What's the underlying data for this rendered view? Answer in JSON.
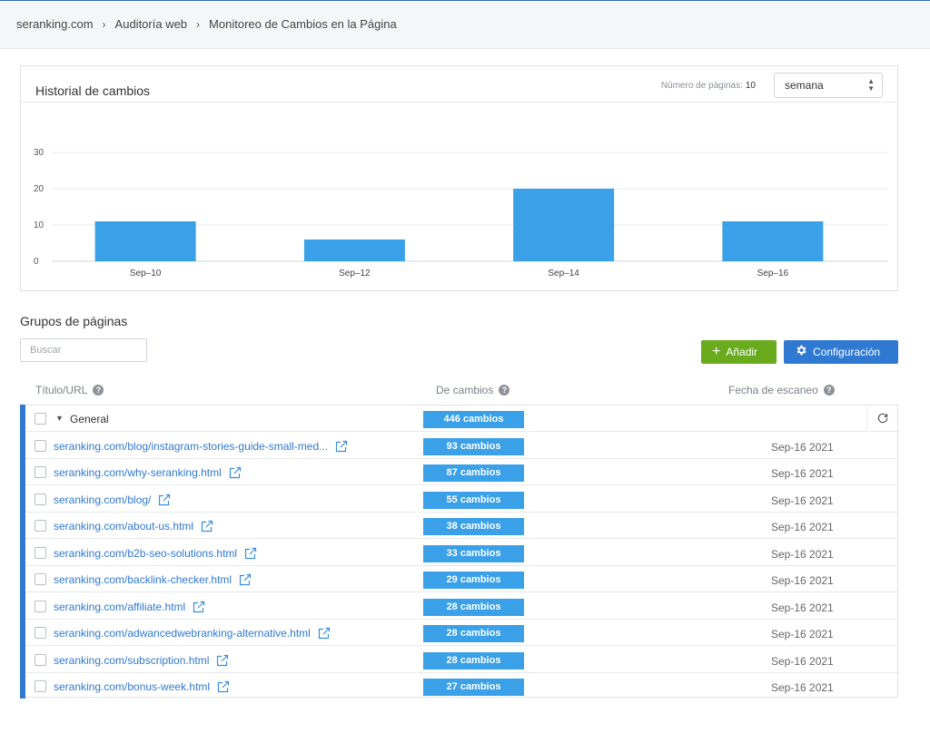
{
  "breadcrumb": [
    "seranking.com",
    "Auditoría web",
    "Monitoreo de Cambios en la Página"
  ],
  "breadcrumb_sep": "›",
  "history": {
    "title": "Historial de cambios",
    "pages_label": "Número de páginas:",
    "pages_value": "10",
    "period": "semana"
  },
  "chart_data": {
    "type": "bar",
    "categories": [
      "Sep–10",
      "Sep–12",
      "Sep–14",
      "Sep–16"
    ],
    "values": [
      11,
      6,
      20,
      11
    ],
    "yticks": [
      0,
      10,
      20,
      30
    ],
    "ylim": [
      0,
      30
    ],
    "grid": true,
    "color": "#3aa0e8"
  },
  "groups": {
    "title": "Grupos de páginas",
    "search_placeholder": "Buscar",
    "add_label": "Añadir",
    "config_label": "Configuración"
  },
  "columns": {
    "title": "Título/URL",
    "changes": "De cambios",
    "date": "Fecha de escaneo"
  },
  "group_row": {
    "label": "General",
    "changes": "446 cambios"
  },
  "rows": [
    {
      "url": "seranking.com/blog/instagram-stories-guide-small-med...",
      "changes": "93 cambios",
      "date": "Sep-16 2021"
    },
    {
      "url": "seranking.com/why-seranking.html",
      "changes": "87 cambios",
      "date": "Sep-16 2021"
    },
    {
      "url": "seranking.com/blog/",
      "changes": "55 cambios",
      "date": "Sep-16 2021"
    },
    {
      "url": "seranking.com/about-us.html",
      "changes": "38 cambios",
      "date": "Sep-16 2021"
    },
    {
      "url": "seranking.com/b2b-seo-solutions.html",
      "changes": "33 cambios",
      "date": "Sep-16 2021"
    },
    {
      "url": "seranking.com/backlink-checker.html",
      "changes": "29 cambios",
      "date": "Sep-16 2021"
    },
    {
      "url": "seranking.com/affiliate.html",
      "changes": "28 cambios",
      "date": "Sep-16 2021"
    },
    {
      "url": "seranking.com/adwancedwebranking-alternative.html",
      "changes": "28 cambios",
      "date": "Sep-16 2021"
    },
    {
      "url": "seranking.com/subscription.html",
      "changes": "28 cambios",
      "date": "Sep-16 2021"
    },
    {
      "url": "seranking.com/bonus-week.html",
      "changes": "27 cambios",
      "date": "Sep-16 2021"
    }
  ]
}
